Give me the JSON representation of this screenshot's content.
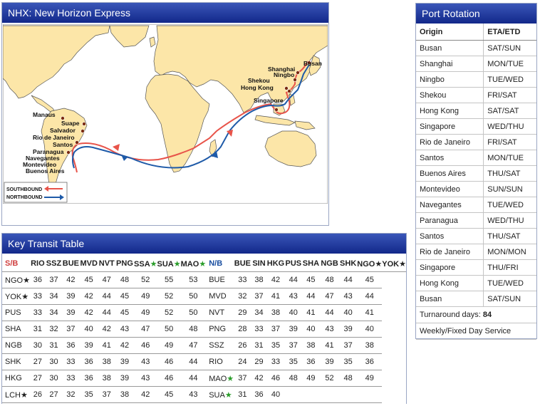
{
  "map_panel": {
    "title": "NHX: New Horizon Express",
    "legend": {
      "southbound": "SOUTHBOUND",
      "northbound": "NORTHBOUND"
    },
    "ports": {
      "busan": "Busan",
      "shanghai": "Shanghai",
      "ningbo": "Ningbo",
      "shekou": "Shekou",
      "hongkong": "Hong Kong",
      "singapore": "Singapore",
      "manaus": "Manaus",
      "suape": "Suape",
      "salvador": "Salvador",
      "rio": "Rio de Janeiro",
      "santos": "Santos",
      "paranagua": "Paranagua",
      "navegantes": "Navegantes",
      "montevideo": "Montevideo",
      "buenosaires": "Buenos Aires"
    },
    "colors": {
      "ocean": "#ffffff",
      "land": "#fce6a8",
      "coast": "#555555",
      "southbound": "#e8544a",
      "northbound": "#1e5aa8"
    }
  },
  "rotation": {
    "title": "Port Rotation",
    "headers": [
      "Origin",
      "ETA/ETD"
    ],
    "rows": [
      [
        "Busan",
        "SAT/SUN"
      ],
      [
        "Shanghai",
        "MON/TUE"
      ],
      [
        "Ningbo",
        "TUE/WED"
      ],
      [
        "Shekou",
        "FRI/SAT"
      ],
      [
        "Hong Kong",
        "SAT/SAT"
      ],
      [
        "Singapore",
        "WED/THU"
      ],
      [
        "Rio de Janeiro",
        "FRI/SAT"
      ],
      [
        "Santos",
        "MON/TUE"
      ],
      [
        "Buenos Aires",
        "THU/SAT"
      ],
      [
        "Montevideo",
        "SUN/SUN"
      ],
      [
        "Navegantes",
        "TUE/WED"
      ],
      [
        "Paranagua",
        "WED/THU"
      ],
      [
        "Santos",
        "THU/SAT"
      ],
      [
        "Rio de Janeiro",
        "MON/MON"
      ],
      [
        "Singapore",
        "THU/FRI"
      ],
      [
        "Hong Kong",
        "TUE/WED"
      ],
      [
        "Busan",
        "SAT/SUN"
      ]
    ],
    "turnaround_label": "Turnaround days:",
    "turnaround_value": "84",
    "service_note": "Weekly/Fixed Day Service"
  },
  "transit": {
    "title": "Key Transit Table",
    "sb_label": "S/B",
    "nb_label": "N/B",
    "sb_headers": [
      "RIO",
      "SSZ",
      "BUE",
      "MVD",
      "NVT",
      "PNG",
      "SSA",
      "SUA",
      "MAO"
    ],
    "nb_headers": [
      "BUE",
      "SIN",
      "HKG",
      "PUS",
      "SHA",
      "NGB",
      "SHK",
      "NGO",
      "YOK"
    ],
    "star": "★",
    "sb_rows": [
      {
        "port": "NGO",
        "star": true,
        "vals": [
          "36",
          "37",
          "42",
          "45",
          "47",
          "48",
          "52",
          "55",
          "53"
        ]
      },
      {
        "port": "YOK",
        "star": true,
        "vals": [
          "33",
          "34",
          "39",
          "42",
          "44",
          "45",
          "49",
          "52",
          "50"
        ]
      },
      {
        "port": "PUS",
        "star": false,
        "vals": [
          "33",
          "34",
          "39",
          "42",
          "44",
          "45",
          "49",
          "52",
          "50"
        ]
      },
      {
        "port": "SHA",
        "star": false,
        "vals": [
          "31",
          "32",
          "37",
          "40",
          "42",
          "43",
          "47",
          "50",
          "48"
        ]
      },
      {
        "port": "NGB",
        "star": false,
        "vals": [
          "30",
          "31",
          "36",
          "39",
          "41",
          "42",
          "46",
          "49",
          "47"
        ]
      },
      {
        "port": "SHK",
        "star": false,
        "vals": [
          "27",
          "30",
          "33",
          "36",
          "38",
          "39",
          "43",
          "46",
          "44"
        ]
      },
      {
        "port": "HKG",
        "star": false,
        "vals": [
          "27",
          "30",
          "33",
          "36",
          "38",
          "39",
          "43",
          "46",
          "44"
        ]
      },
      {
        "port": "LCH",
        "star": true,
        "vals": [
          "26",
          "27",
          "32",
          "35",
          "37",
          "38",
          "42",
          "45",
          "43"
        ]
      }
    ],
    "nb_rows": [
      {
        "port": "BUE",
        "star": false,
        "vals": [
          "33",
          "38",
          "42",
          "44",
          "45",
          "48",
          "44",
          "45"
        ]
      },
      {
        "port": "MVD",
        "star": false,
        "vals": [
          "32",
          "37",
          "41",
          "43",
          "44",
          "47",
          "43",
          "44"
        ]
      },
      {
        "port": "NVT",
        "star": false,
        "vals": [
          "29",
          "34",
          "38",
          "40",
          "41",
          "44",
          "40",
          "41"
        ]
      },
      {
        "port": "PNG",
        "star": false,
        "vals": [
          "28",
          "33",
          "37",
          "39",
          "40",
          "43",
          "39",
          "40"
        ]
      },
      {
        "port": "SSZ",
        "star": false,
        "vals": [
          "26",
          "31",
          "35",
          "37",
          "38",
          "41",
          "37",
          "38"
        ]
      },
      {
        "port": "RIO",
        "star": false,
        "vals": [
          "24",
          "29",
          "33",
          "35",
          "36",
          "39",
          "35",
          "36"
        ]
      },
      {
        "port": "MAO",
        "star": true,
        "vals": [
          "37",
          "42",
          "46",
          "48",
          "49",
          "52",
          "48",
          "49"
        ]
      },
      {
        "port": "SUA",
        "star": true,
        "vals": [
          "31",
          "36",
          "40",
          "",
          "",
          "",
          "",
          ""
        ]
      }
    ]
  }
}
